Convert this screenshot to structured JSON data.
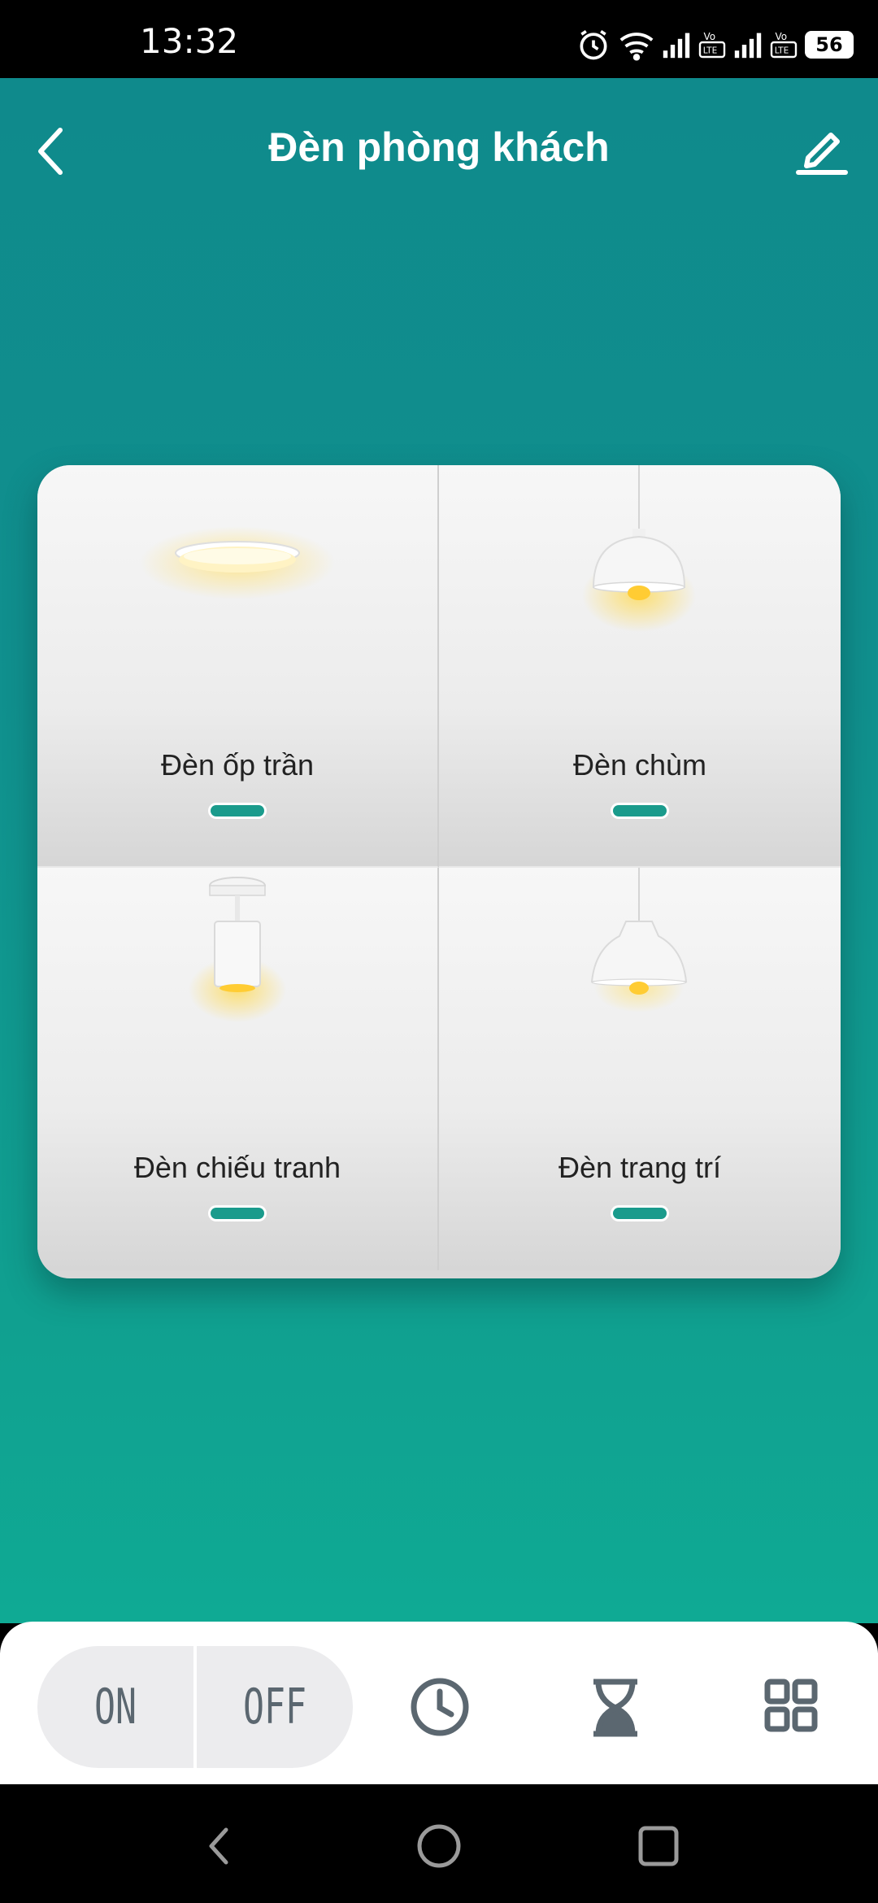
{
  "status_bar": {
    "time": "13:32",
    "battery": "56",
    "icons": [
      "alarm-icon",
      "wifi-icon",
      "signal-icon",
      "volte-icon",
      "signal-icon",
      "volte-icon",
      "battery-icon"
    ]
  },
  "header": {
    "title": "Đèn phòng khách",
    "back_icon": "chevron-left-icon",
    "edit_icon": "pencil-icon"
  },
  "lights": [
    {
      "label": "Đèn ốp trần",
      "icon": "ceiling-light-icon"
    },
    {
      "label": "Đèn chùm",
      "icon": "pendant-light-icon"
    },
    {
      "label": "Đèn chiếu tranh",
      "icon": "spot-light-icon"
    },
    {
      "label": "Đèn trang trí",
      "icon": "decor-pendant-icon"
    }
  ],
  "bottom_bar": {
    "on_label": "ON",
    "off_label": "OFF",
    "tools": [
      "clock-icon",
      "hourglass-icon",
      "grid-icon"
    ]
  },
  "nav": [
    "back-nav-icon",
    "home-nav-icon",
    "recents-nav-icon"
  ],
  "colors": {
    "accent": "#1a9b8c",
    "background_top": "#0f8a8c",
    "background_bottom": "#0faa94"
  }
}
